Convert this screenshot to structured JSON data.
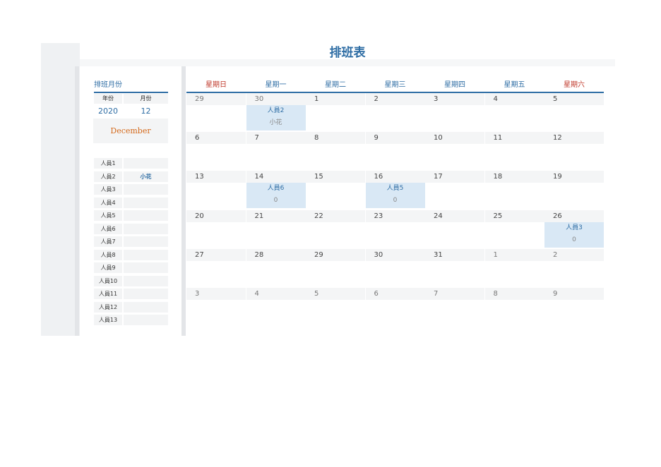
{
  "title": "排班表",
  "month_panel": {
    "header": "排班月份",
    "year_label": "年份",
    "month_label": "月份",
    "year": "2020",
    "month": "12",
    "month_name": "December"
  },
  "staff": [
    {
      "name": "人員1",
      "assignee": ""
    },
    {
      "name": "人員2",
      "assignee": "小花"
    },
    {
      "name": "人員3",
      "assignee": ""
    },
    {
      "name": "人員4",
      "assignee": ""
    },
    {
      "name": "人員5",
      "assignee": ""
    },
    {
      "name": "人員6",
      "assignee": ""
    },
    {
      "name": "人員7",
      "assignee": ""
    },
    {
      "name": "人員8",
      "assignee": ""
    },
    {
      "name": "人員9",
      "assignee": ""
    },
    {
      "name": "人員10",
      "assignee": ""
    },
    {
      "name": "人員11",
      "assignee": ""
    },
    {
      "name": "人員12",
      "assignee": ""
    },
    {
      "name": "人員13",
      "assignee": ""
    }
  ],
  "weekdays": [
    "星期日",
    "星期一",
    "星期二",
    "星期三",
    "星期四",
    "星期五",
    "星期六"
  ],
  "weeks": [
    [
      "29",
      "30",
      "1",
      "2",
      "3",
      "4",
      "5"
    ],
    [
      "6",
      "7",
      "8",
      "9",
      "10",
      "11",
      "12"
    ],
    [
      "13",
      "14",
      "15",
      "16",
      "17",
      "18",
      "19"
    ],
    [
      "20",
      "21",
      "22",
      "23",
      "24",
      "25",
      "26"
    ],
    [
      "27",
      "28",
      "29",
      "30",
      "31",
      "1",
      "2"
    ],
    [
      "3",
      "4",
      "5",
      "6",
      "7",
      "8",
      "9"
    ]
  ],
  "events": [
    {
      "week": 0,
      "day": 1,
      "who": "人員2",
      "sub": "小花"
    },
    {
      "week": 2,
      "day": 1,
      "who": "人員6",
      "sub": "0"
    },
    {
      "week": 2,
      "day": 3,
      "who": "人員5",
      "sub": "0"
    },
    {
      "week": 3,
      "day": 6,
      "who": "人員3",
      "sub": "0"
    }
  ],
  "colors": {
    "accent": "#2e6da4",
    "weekend": "#c0392b",
    "month_name": "#d4691b",
    "event_bg": "#d9e8f5"
  }
}
